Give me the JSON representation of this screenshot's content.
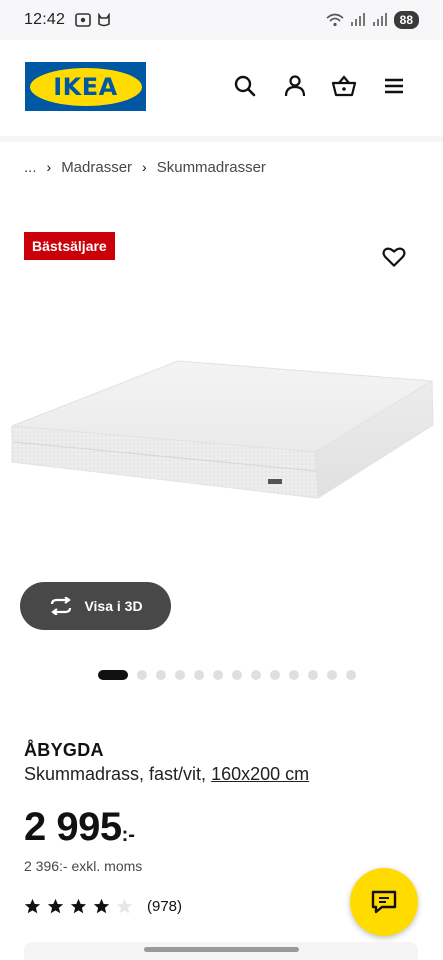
{
  "status_bar": {
    "time": "12:42",
    "battery": "88"
  },
  "brand": {
    "logo_text": "IKEA",
    "blue": "#0058a3",
    "yellow": "#ffdb00"
  },
  "header": {
    "icons": [
      "search-icon",
      "profile-icon",
      "cart-icon",
      "menu-icon"
    ]
  },
  "breadcrumb": {
    "ellipsis": "...",
    "items": [
      "Madrasser",
      "Skummadrasser"
    ]
  },
  "badge": {
    "label": "Bästsäljare",
    "color": "#cc0008"
  },
  "gallery": {
    "view3d_label": "Visa i 3D",
    "total_images": 13,
    "active_index": 0
  },
  "product": {
    "name": "ÅBYGDA",
    "description": "Skummadrass, fast/vit,",
    "size": "160x200 cm",
    "price": "2 995",
    "price_suffix": ":-",
    "price_exkl": "2 396:- exkl. moms",
    "rating_value": 4,
    "rating_max": 5,
    "review_count": "(978)"
  }
}
